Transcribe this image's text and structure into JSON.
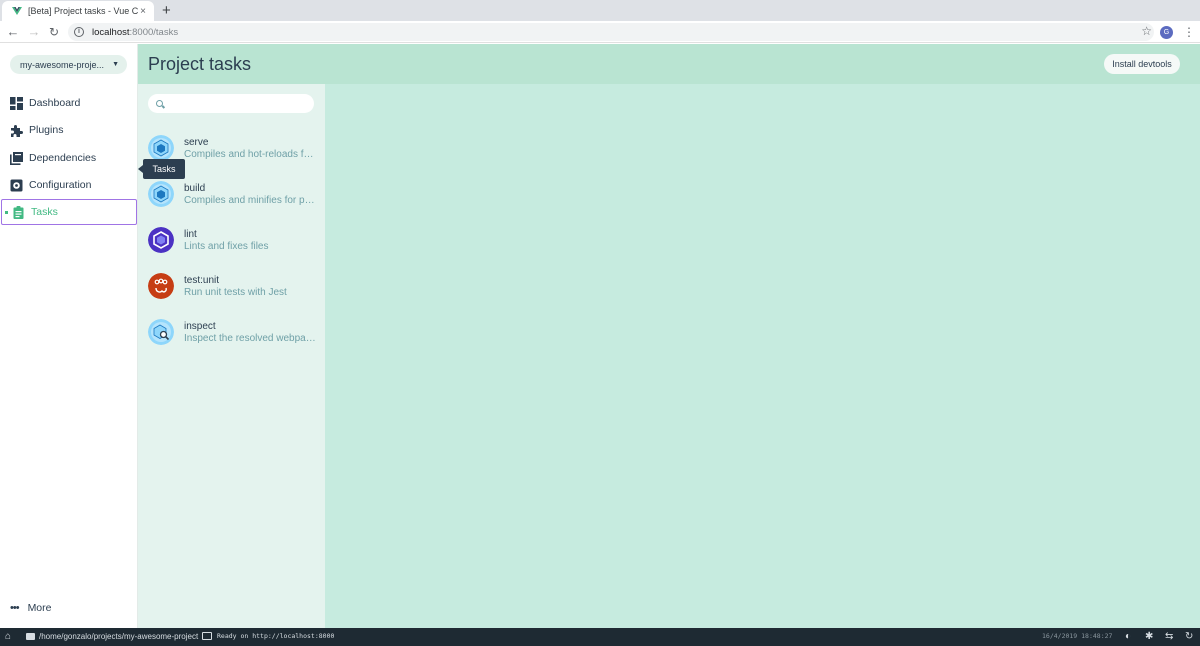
{
  "browser": {
    "tab_title": "[Beta] Project tasks - Vue CLI",
    "tab_close": "×",
    "new_tab": "+",
    "url_host": "localhost",
    "url_path": ":8000/tasks",
    "avatar_initial": "G",
    "icons": [
      "back-icon",
      "forward-icon",
      "reload-icon",
      "info-icon",
      "star-icon",
      "menu-icon"
    ]
  },
  "sidebar": {
    "project_selector": "my-awesome-proje...",
    "items": [
      {
        "label": "Dashboard",
        "icon": "dashboard-icon",
        "active": false
      },
      {
        "label": "Plugins",
        "icon": "puzzle-icon",
        "active": false
      },
      {
        "label": "Dependencies",
        "icon": "library-icon",
        "active": false
      },
      {
        "label": "Configuration",
        "icon": "gear-icon",
        "active": false
      },
      {
        "label": "Tasks",
        "icon": "clipboard-icon",
        "active": true
      }
    ],
    "tooltip": "Tasks",
    "more_label": "More",
    "accent_color": "#42b983",
    "focus_color": "#a074e5"
  },
  "header": {
    "title": "Project tasks",
    "install_devtools": "Install devtools",
    "color": "#b9e4d2"
  },
  "tasks": {
    "search_placeholder": "",
    "items": [
      {
        "name": "serve",
        "description": "Compiles and hot-reloads for development",
        "icon": "webpack-icon"
      },
      {
        "name": "build",
        "description": "Compiles and minifies for production",
        "icon": "webpack-icon"
      },
      {
        "name": "lint",
        "description": "Lints and fixes files",
        "icon": "eslint-icon"
      },
      {
        "name": "test:unit",
        "description": "Run unit tests with Jest",
        "icon": "jest-icon"
      },
      {
        "name": "inspect",
        "description": "Inspect the resolved webpack config",
        "icon": "webpack-inspect-icon"
      }
    ]
  },
  "taskbar": {
    "path": "/home/gonzalo/projects/my-awesome-project",
    "status": "Ready on http://localhost:8000",
    "datetime": "16/4/2019 18:48:27"
  }
}
